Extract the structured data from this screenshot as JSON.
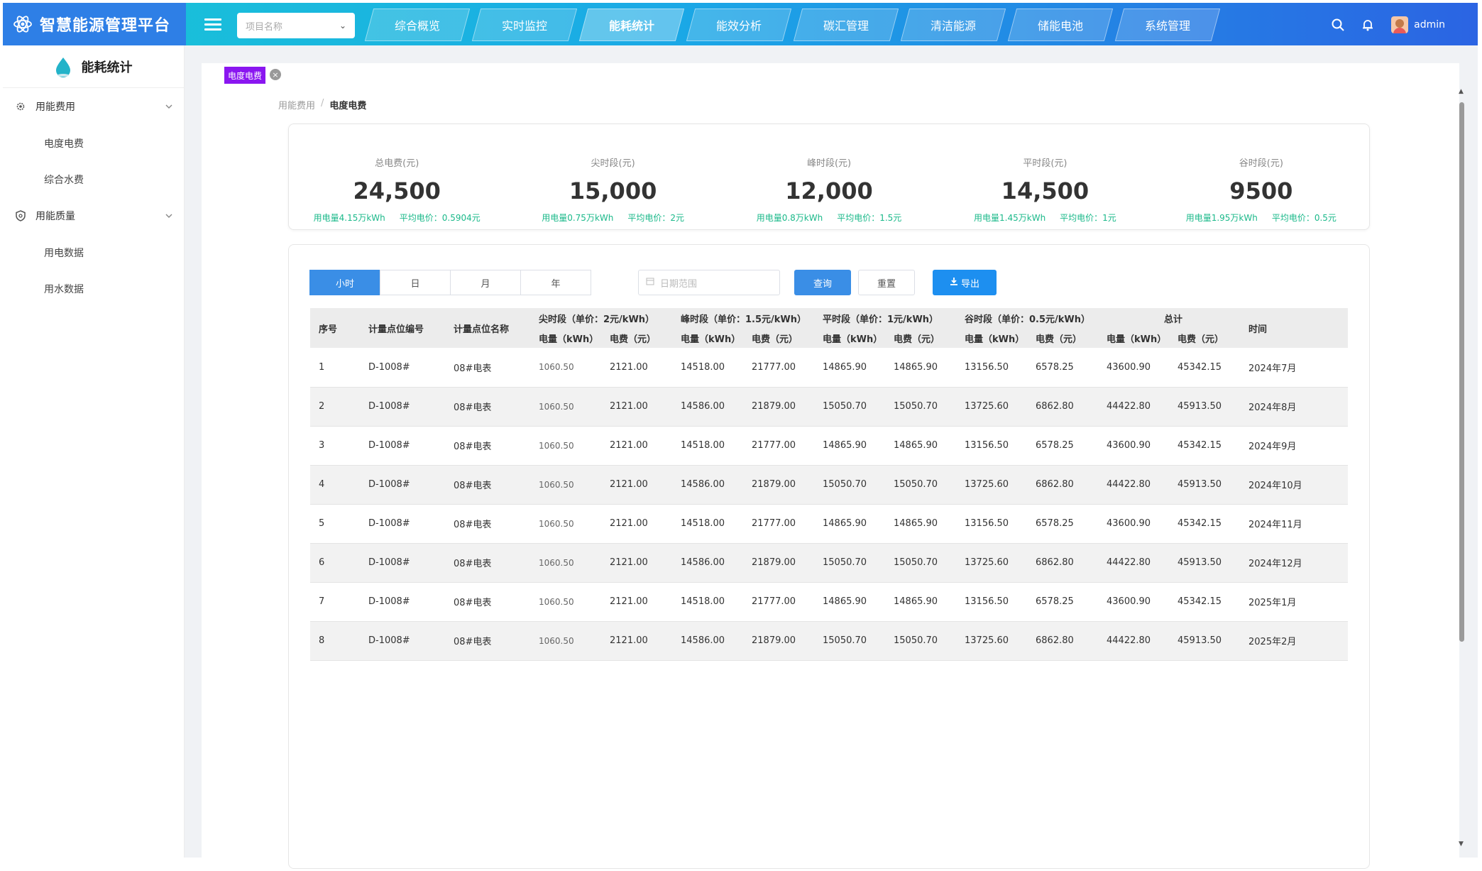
{
  "app": {
    "title": "智慧能源管理平台"
  },
  "header": {
    "project_placeholder": "项目名称",
    "nav": [
      "综合概览",
      "实时监控",
      "能耗统计",
      "能效分析",
      "碳汇管理",
      "清洁能源",
      "储能电池",
      "系统管理"
    ],
    "active_nav": "能耗统计",
    "user": "admin"
  },
  "sidebar": {
    "title": "能耗统计",
    "groups": [
      {
        "label": "用能费用",
        "items": [
          "电度电费",
          "综合水费"
        ]
      },
      {
        "label": "用能质量",
        "items": [
          "用电数据",
          "用水数据"
        ]
      }
    ]
  },
  "tab": {
    "label": "电度电费"
  },
  "breadcrumb": {
    "parent": "用能费用",
    "current": "电度电费"
  },
  "stats": [
    {
      "label": "总电费(元)",
      "value": "24,500",
      "usage": "用电量4.15万kWh",
      "price": "平均电价：0.5904元"
    },
    {
      "label": "尖时段(元)",
      "value": "15,000",
      "usage": "用电量0.75万kWh",
      "price": "平均电价：2元"
    },
    {
      "label": "峰时段(元)",
      "value": "12,000",
      "usage": "用电量0.8万kWh",
      "price": "平均电价：1.5元"
    },
    {
      "label": "平时段(元)",
      "value": "14,500",
      "usage": "用电量1.45万kWh",
      "price": "平均电价：1元"
    },
    {
      "label": "谷时段(元)",
      "value": "9500",
      "usage": "用电量1.95万kWh",
      "price": "平均电价：0.5元"
    }
  ],
  "filters": {
    "periods": [
      "小时",
      "日",
      "月",
      "年"
    ],
    "active_period": "小时",
    "date_placeholder": "日期范围",
    "query": "查询",
    "reset": "重置",
    "export": "导出"
  },
  "table": {
    "headers": {
      "index": "序号",
      "code": "计量点位编号",
      "name": "计量点位名称",
      "sharp": "尖时段（单价：2元/kWh）",
      "peak": "峰时段（单价：1.5元/kWh）",
      "flat": "平时段（单价：1元/kWh）",
      "valley": "谷时段（单价：0.5元/kWh）",
      "total": "总计",
      "time": "时间",
      "kwh": "电量（kWh）",
      "fee": "电费（元）"
    },
    "rows": [
      [
        "1",
        "D-1008#",
        "08#电表",
        "1060.50",
        "2121.00",
        "14518.00",
        "21777.00",
        "14865.90",
        "14865.90",
        "13156.50",
        "6578.25",
        "43600.90",
        "45342.15",
        "2024年7月"
      ],
      [
        "2",
        "D-1008#",
        "08#电表",
        "1060.50",
        "2121.00",
        "14586.00",
        "21879.00",
        "15050.70",
        "15050.70",
        "13725.60",
        "6862.80",
        "44422.80",
        "45913.50",
        "2024年8月"
      ],
      [
        "3",
        "D-1008#",
        "08#电表",
        "1060.50",
        "2121.00",
        "14518.00",
        "21777.00",
        "14865.90",
        "14865.90",
        "13156.50",
        "6578.25",
        "43600.90",
        "45342.15",
        "2024年9月"
      ],
      [
        "4",
        "D-1008#",
        "08#电表",
        "1060.50",
        "2121.00",
        "14586.00",
        "21879.00",
        "15050.70",
        "15050.70",
        "13725.60",
        "6862.80",
        "44422.80",
        "45913.50",
        "2024年10月"
      ],
      [
        "5",
        "D-1008#",
        "08#电表",
        "1060.50",
        "2121.00",
        "14518.00",
        "21777.00",
        "14865.90",
        "14865.90",
        "13156.50",
        "6578.25",
        "43600.90",
        "45342.15",
        "2024年11月"
      ],
      [
        "6",
        "D-1008#",
        "08#电表",
        "1060.50",
        "2121.00",
        "14586.00",
        "21879.00",
        "15050.70",
        "15050.70",
        "13725.60",
        "6862.80",
        "44422.80",
        "45913.50",
        "2024年12月"
      ],
      [
        "7",
        "D-1008#",
        "08#电表",
        "1060.50",
        "2121.00",
        "14518.00",
        "21777.00",
        "14865.90",
        "14865.90",
        "13156.50",
        "6578.25",
        "43600.90",
        "45342.15",
        "2025年1月"
      ],
      [
        "8",
        "D-1008#",
        "08#电表",
        "1060.50",
        "2121.00",
        "14586.00",
        "21879.00",
        "15050.70",
        "15050.70",
        "13725.60",
        "6862.80",
        "44422.80",
        "45913.50",
        "2025年2月"
      ]
    ]
  },
  "colors": {
    "accent": "#3a8ee6",
    "tag": "#8a16f0",
    "green": "#1bb98a",
    "brand": "#2e7fe6"
  }
}
